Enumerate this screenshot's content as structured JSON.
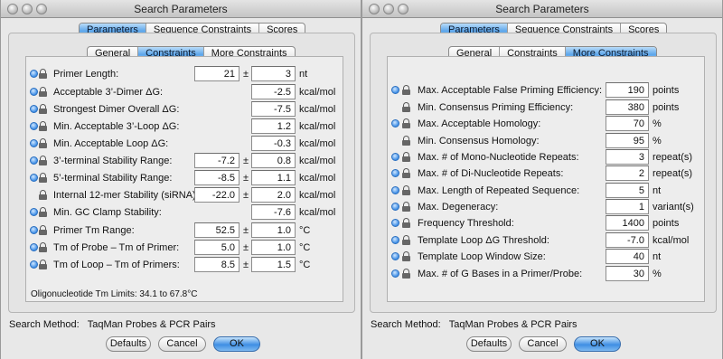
{
  "window_title": "Search Parameters",
  "main_tabs": [
    "Parameters",
    "Sequence Constraints",
    "Scores"
  ],
  "sub_tabs": [
    "General",
    "Constraints",
    "More Constraints"
  ],
  "left": {
    "rows": [
      {
        "label": "Primer Length:",
        "v1": "21",
        "v2": "3",
        "unit": "nt"
      },
      {
        "label": "Acceptable 3’-Dimer ΔG:",
        "v2": "-2.5",
        "unit": "kcal/mol"
      },
      {
        "label": "Strongest Dimer Overall ΔG:",
        "v2": "-7.5",
        "unit": "kcal/mol"
      },
      {
        "label": "Min. Acceptable 3’-Loop ΔG:",
        "v2": "1.2",
        "unit": "kcal/mol"
      },
      {
        "label": "Min. Acceptable Loop ΔG:",
        "v2": "-0.3",
        "unit": "kcal/mol"
      },
      {
        "label": "3’-terminal Stability Range:",
        "v1": "-7.2",
        "v2": "0.8",
        "unit": "kcal/mol"
      },
      {
        "label": "5’-terminal Stability Range:",
        "v1": "-8.5",
        "v2": "1.1",
        "unit": "kcal/mol"
      },
      {
        "label": "Internal 12-mer Stability (siRNA):",
        "v1": "-22.0",
        "v2": "2.0",
        "unit": "kcal/mol"
      },
      {
        "label": "Min. GC Clamp Stability:",
        "v2": "-7.6",
        "unit": "kcal/mol"
      },
      {
        "label": "Primer Tm Range:",
        "v1": "52.5",
        "v2": "1.0",
        "unit": "°C"
      },
      {
        "label": "Tm of Probe – Tm of Primer:",
        "v1": "5.0",
        "v2": "1.0",
        "unit": "°C"
      },
      {
        "label": "Tm of Loop – Tm of Primers:",
        "v1": "8.5",
        "v2": "1.5",
        "unit": "°C"
      }
    ],
    "note": "Oligonucleotide Tm Limits: 34.1 to 67.8°C"
  },
  "right": {
    "rows": [
      {
        "label": "Max. Acceptable False Priming Efficiency:",
        "value": "190",
        "unit": "points"
      },
      {
        "label": "Min. Consensus Priming Efficiency:",
        "value": "380",
        "unit": "points"
      },
      {
        "label": "Max. Acceptable Homology:",
        "value": "70",
        "unit": "%"
      },
      {
        "label": "Min. Consensus Homology:",
        "value": "95",
        "unit": "%"
      },
      {
        "label": "Max. # of Mono-Nucleotide Repeats:",
        "value": "3",
        "unit": "repeat(s)"
      },
      {
        "label": "Max. # of Di-Nucleotide Repeats:",
        "value": "2",
        "unit": "repeat(s)"
      },
      {
        "label": "Max. Length of Repeated Sequence:",
        "value": "5",
        "unit": "nt"
      },
      {
        "label": "Max. Degeneracy:",
        "value": "1",
        "unit": "variant(s)"
      },
      {
        "label": "Frequency Threshold:",
        "value": "1400",
        "unit": "points"
      },
      {
        "label": "Template Loop ΔG Threshold:",
        "value": "-7.0",
        "unit": "kcal/mol"
      },
      {
        "label": "Template Loop Window Size:",
        "value": "40",
        "unit": "nt"
      },
      {
        "label": "Max. # of G Bases in a Primer/Probe:",
        "value": "30",
        "unit": "%"
      }
    ]
  },
  "pm_symbol": "±",
  "search_method_label": "Search Method:",
  "search_method_value": "TaqMan Probes & PCR Pairs",
  "buttons": {
    "defaults": "Defaults",
    "cancel": "Cancel",
    "ok": "OK"
  },
  "colors": {
    "accent": "#5ea6ea",
    "window_bg": "#e8e8e8"
  }
}
